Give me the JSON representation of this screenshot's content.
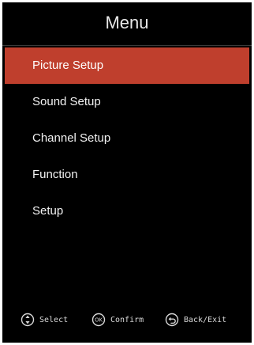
{
  "menu": {
    "title": "Menu",
    "items": [
      {
        "label": "Picture Setup",
        "selected": true
      },
      {
        "label": "Sound Setup",
        "selected": false
      },
      {
        "label": "Channel Setup",
        "selected": false
      },
      {
        "label": "Function",
        "selected": false
      },
      {
        "label": "Setup",
        "selected": false
      }
    ]
  },
  "footer": {
    "select_label": "Select",
    "confirm_label": "Confirm",
    "ok_icon_text": "OK",
    "back_label": "Back/Exit"
  },
  "colors": {
    "background": "#000000",
    "highlight": "#bf3f2d",
    "text": "#f2f2f2"
  },
  "icons": {
    "select": "up-down-arrows-icon",
    "confirm": "ok-button-icon",
    "back": "back-arrow-icon"
  }
}
